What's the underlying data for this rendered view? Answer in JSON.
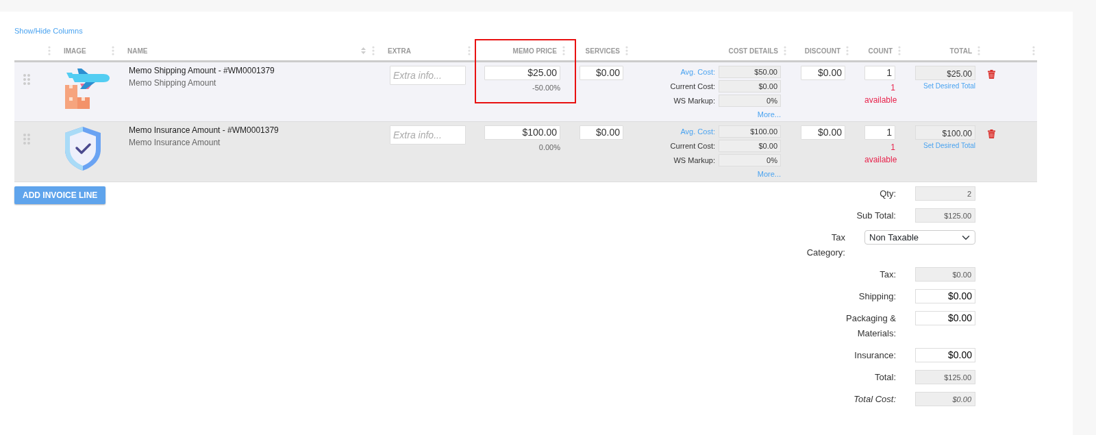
{
  "show_hide_link": "Show/Hide Columns",
  "columns": [
    {
      "label": "IMAGE",
      "sortable": false,
      "highlighted": false
    },
    {
      "label": "NAME",
      "sortable": true,
      "highlighted": false
    },
    {
      "label": "EXTRA",
      "sortable": false,
      "highlighted": false
    },
    {
      "label": "MEMO PRICE",
      "sortable": false,
      "highlighted": true
    },
    {
      "label": "SERVICES",
      "sortable": false,
      "highlighted": false
    },
    {
      "label": "COST DETAILS",
      "sortable": false,
      "highlighted": false
    },
    {
      "label": "DISCOUNT",
      "sortable": false,
      "highlighted": false
    },
    {
      "label": "COUNT",
      "sortable": false,
      "highlighted": false
    },
    {
      "label": "TOTAL",
      "sortable": false,
      "highlighted": false
    }
  ],
  "rows": [
    {
      "hovered": false,
      "kind": "shipping",
      "name": "Memo Shipping Amount - #WM0001379",
      "subtitle": "Memo Shipping Amount",
      "extra_placeholder": "Extra info...",
      "memo_price": "$25.00",
      "memo_change": "-50.00%",
      "services": "$0.00",
      "cost_details": [
        {
          "label": "Avg. Cost:",
          "value": "$50.00",
          "link": true
        },
        {
          "label": "Current Cost:",
          "value": "$0.00",
          "link": false
        },
        {
          "label": "WS Markup:",
          "value": "0%",
          "link": false
        }
      ],
      "more": "More...",
      "discount": "$0.00",
      "count": "1",
      "availability": "1 available",
      "total": "$25.00",
      "set_total": "Set Desired Total"
    },
    {
      "hovered": true,
      "kind": "insurance",
      "name": "Memo Insurance Amount - #WM0001379",
      "subtitle": "Memo Insurance Amount",
      "extra_placeholder": "Extra info...",
      "memo_price": "$100.00",
      "memo_change": "0.00%",
      "services": "$0.00",
      "cost_details": [
        {
          "label": "Avg. Cost:",
          "value": "$100.00",
          "link": true
        },
        {
          "label": "Current Cost:",
          "value": "$0.00",
          "link": false
        },
        {
          "label": "WS Markup:",
          "value": "0%",
          "link": false
        }
      ],
      "more": "More...",
      "discount": "$0.00",
      "count": "1",
      "availability": "1 available",
      "total": "$100.00",
      "set_total": "Set Desired Total"
    }
  ],
  "add_button": "ADD INVOICE LINE",
  "summary": [
    {
      "kind": "readonly",
      "label": "Qty:",
      "value": "2",
      "italic": false
    },
    {
      "kind": "readonly",
      "label": "Sub Total:",
      "value": "$125.00",
      "italic": false
    },
    {
      "kind": "select",
      "label": "Tax Category:",
      "value": "Non Taxable",
      "italic": false
    },
    {
      "kind": "readonly",
      "label": "Tax:",
      "value": "$0.00",
      "italic": false
    },
    {
      "kind": "input",
      "label": "Shipping:",
      "value": "$0.00",
      "italic": false
    },
    {
      "kind": "input",
      "label": "Packaging & Materials:",
      "value": "$0.00",
      "italic": false
    },
    {
      "kind": "input",
      "label": "Insurance:",
      "value": "$0.00",
      "italic": false
    },
    {
      "kind": "readonly",
      "label": "Total:",
      "value": "$125.00",
      "italic": false
    },
    {
      "kind": "readonly",
      "label": "Total Cost:",
      "value": "$0.00",
      "italic": true
    }
  ]
}
